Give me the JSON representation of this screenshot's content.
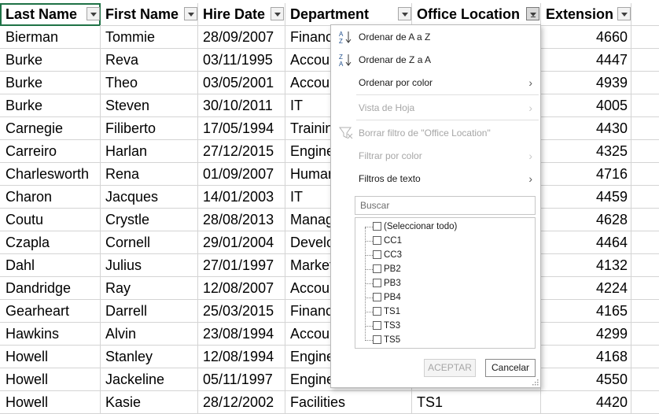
{
  "columns": [
    {
      "label": "Last Name",
      "filter_active": false
    },
    {
      "label": "First Name",
      "filter_active": false
    },
    {
      "label": "Hire Date",
      "filter_active": false
    },
    {
      "label": "Department",
      "filter_active": false
    },
    {
      "label": "Office Location",
      "filter_active": true
    },
    {
      "label": "Extension",
      "filter_active": false
    }
  ],
  "rows": [
    [
      "Bierman",
      "Tommie",
      "28/09/2007",
      "Finance",
      "",
      "4660"
    ],
    [
      "Burke",
      "Reva",
      "03/11/1995",
      "Accounting",
      "",
      "4447"
    ],
    [
      "Burke",
      "Theo",
      "03/05/2001",
      "Accounting",
      "",
      "4939"
    ],
    [
      "Burke",
      "Steven",
      "30/10/2011",
      "IT",
      "",
      "4005"
    ],
    [
      "Carnegie",
      "Filiberto",
      "17/05/1994",
      "Training",
      "",
      "4430"
    ],
    [
      "Carreiro",
      "Harlan",
      "27/12/2015",
      "Engineering",
      "",
      "4325"
    ],
    [
      "Charlesworth",
      "Rena",
      "01/09/2007",
      "Human Resources",
      "",
      "4716"
    ],
    [
      "Charon",
      "Jacques",
      "14/01/2003",
      "IT",
      "",
      "4459"
    ],
    [
      "Coutu",
      "Crystle",
      "28/08/2013",
      "Management",
      "",
      "4628"
    ],
    [
      "Czapla",
      "Cornell",
      "29/01/2004",
      "Development",
      "",
      "4464"
    ],
    [
      "Dahl",
      "Julius",
      "27/01/1997",
      "Marketing",
      "",
      "4132"
    ],
    [
      "Dandridge",
      "Ray",
      "12/08/2007",
      "Accounting",
      "",
      "4224"
    ],
    [
      "Gearheart",
      "Darrell",
      "25/03/2015",
      "Finance",
      "",
      "4165"
    ],
    [
      "Hawkins",
      "Alvin",
      "23/08/1994",
      "Accounting",
      "",
      "4299"
    ],
    [
      "Howell",
      "Stanley",
      "12/08/1994",
      "Engineering",
      "",
      "4168"
    ],
    [
      "Howell",
      "Jackeline",
      "05/11/1997",
      "Engineering",
      "",
      "4550"
    ],
    [
      "Howell",
      "Kasie",
      "28/12/2002",
      "Facilities",
      "TS1",
      "4420"
    ]
  ],
  "filter_menu": {
    "sort_az": "Ordenar de A a Z",
    "sort_za": "Ordenar de Z a A",
    "sort_by_color": "Ordenar por color",
    "sheet_view": "Vista de Hoja",
    "clear_filter": "Borrar filtro de \"Office Location\"",
    "filter_by_color": "Filtrar por color",
    "text_filters": "Filtros de texto",
    "search_placeholder": "Buscar",
    "values": [
      "(Seleccionar todo)",
      "CC1",
      "CC3",
      "PB2",
      "PB3",
      "PB4",
      "TS1",
      "TS3",
      "TS5"
    ],
    "ok_label": "ACEPTAR",
    "cancel_label": "Cancelar",
    "icons": [
      "sort-ascending-icon",
      "sort-descending-icon",
      "clear-filter-icon",
      "chevron-right-icon",
      "checkbox-icon",
      "resize-grip-icon"
    ]
  },
  "colors": {
    "selection": "#1f7246",
    "gridline": "#d4d4d4",
    "disabled_text": "#a6a6a6"
  }
}
